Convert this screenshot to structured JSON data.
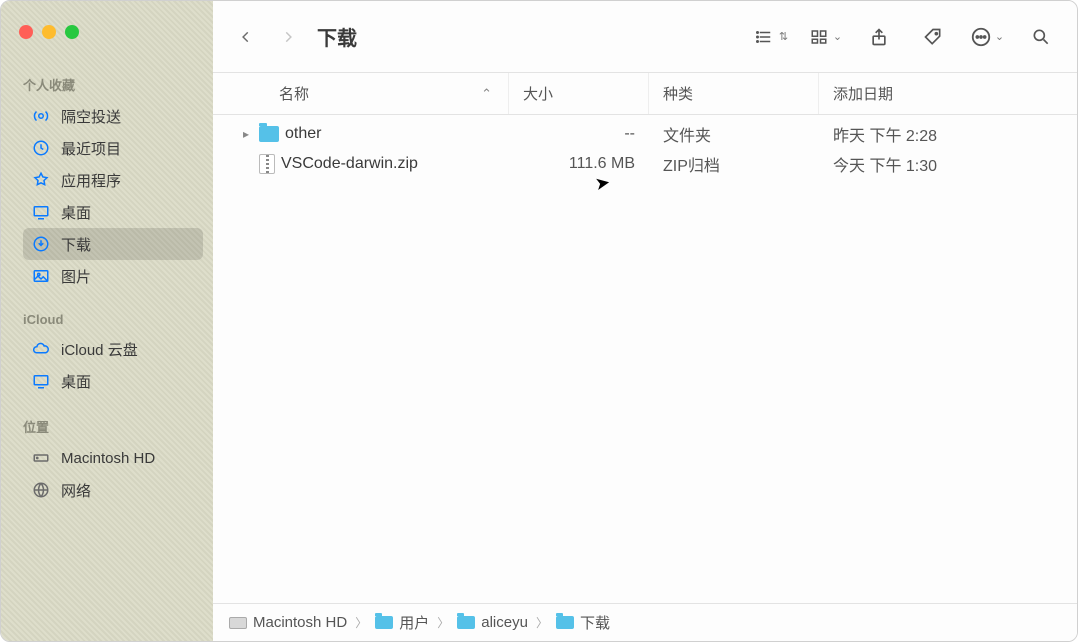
{
  "window_title": "下载",
  "sidebar": {
    "sections": [
      {
        "heading": "个人收藏",
        "items": [
          {
            "label": "隔空投送",
            "icon": "airdrop"
          },
          {
            "label": "最近项目",
            "icon": "clock"
          },
          {
            "label": "应用程序",
            "icon": "apps"
          },
          {
            "label": "桌面",
            "icon": "desktop"
          },
          {
            "label": "下载",
            "icon": "download",
            "selected": true
          },
          {
            "label": "图片",
            "icon": "pictures"
          }
        ]
      },
      {
        "heading": "iCloud",
        "items": [
          {
            "label": "iCloud 云盘",
            "icon": "icloud"
          },
          {
            "label": "桌面",
            "icon": "desktop"
          }
        ]
      },
      {
        "heading": "位置",
        "items": [
          {
            "label": "Macintosh HD",
            "icon": "hdd"
          },
          {
            "label": "网络",
            "icon": "network"
          }
        ]
      }
    ]
  },
  "columns": {
    "name": "名称",
    "size": "大小",
    "kind": "种类",
    "date_added": "添加日期"
  },
  "files": [
    {
      "name": "other",
      "size": "--",
      "kind": "文件夹",
      "date_added": "昨天 下午 2:28",
      "type": "folder",
      "expandable": true
    },
    {
      "name": "VSCode-darwin.zip",
      "size": "111.6 MB",
      "kind": "ZIP归档",
      "date_added": "今天 下午 1:30",
      "type": "zip"
    }
  ],
  "pathbar": [
    {
      "label": "Macintosh HD",
      "icon": "hdd"
    },
    {
      "label": "用户",
      "icon": "folder"
    },
    {
      "label": "aliceyu",
      "icon": "folder"
    },
    {
      "label": "下载",
      "icon": "folder"
    }
  ]
}
